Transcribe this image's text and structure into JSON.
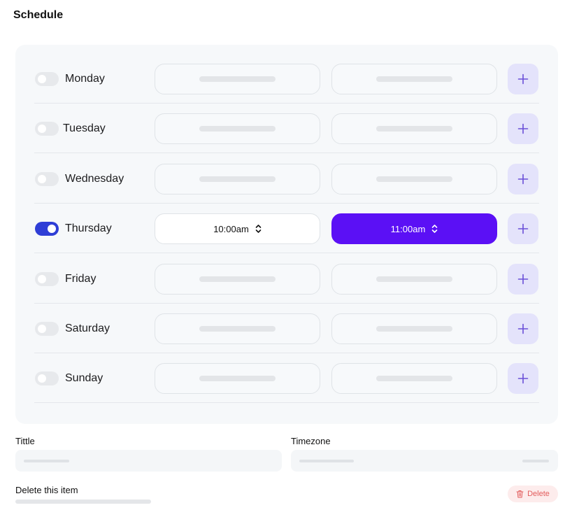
{
  "page": {
    "title": "Schedule"
  },
  "schedule": {
    "days": [
      {
        "label": "Monday",
        "enabled": false,
        "start": "",
        "end": ""
      },
      {
        "label": "Tuesday",
        "enabled": false,
        "start": "",
        "end": ""
      },
      {
        "label": "Wednesday",
        "enabled": false,
        "start": "",
        "end": ""
      },
      {
        "label": "Thursday",
        "enabled": true,
        "start": "10:00am",
        "end": "11:00am"
      },
      {
        "label": "Friday",
        "enabled": false,
        "start": "",
        "end": ""
      },
      {
        "label": "Saturday",
        "enabled": false,
        "start": "",
        "end": ""
      },
      {
        "label": "Sunday",
        "enabled": false,
        "start": "",
        "end": ""
      }
    ]
  },
  "form": {
    "title_label": "Tittle",
    "timezone_label": "Timezone",
    "delete_item_label": "Delete this item",
    "delete_button": "Delete"
  },
  "colors": {
    "accent": "#5b10f5",
    "toggle_on": "#2f3ed6",
    "add_button_bg": "#e4e3fb",
    "add_icon": "#6a4fd8",
    "delete_text": "#e25c5c"
  },
  "icons": {
    "add": "plus-icon",
    "time_selector": "chevron-up-down-icon",
    "delete": "trash-icon"
  }
}
